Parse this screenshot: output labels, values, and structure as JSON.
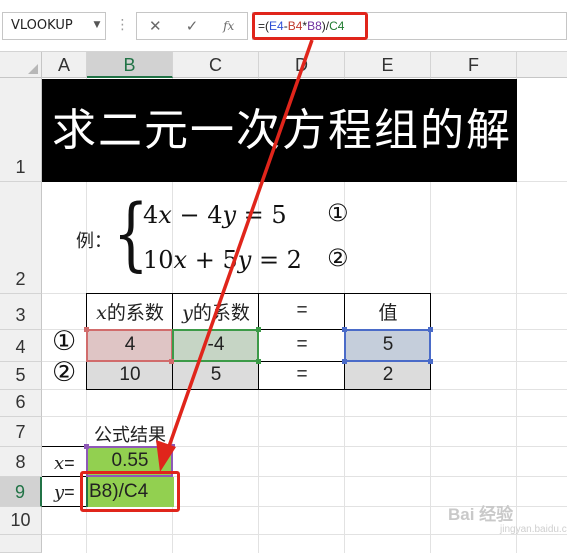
{
  "formula_bar": {
    "name_box": "VLOOKUP",
    "cancel_glyph": "✕",
    "enter_glyph": "✓",
    "fx_label": "fx",
    "formula_parts": [
      {
        "text": "=(",
        "color": "#222222"
      },
      {
        "text": "E4",
        "color": "#2e4fd6"
      },
      {
        "text": "-",
        "color": "#222222"
      },
      {
        "text": "B4",
        "color": "#c0392b"
      },
      {
        "text": "*",
        "color": "#222222"
      },
      {
        "text": "B8",
        "color": "#7030a0"
      },
      {
        "text": ")/",
        "color": "#222222"
      },
      {
        "text": "C4",
        "color": "#1e7a2e"
      }
    ]
  },
  "columns": [
    "A",
    "B",
    "C",
    "D",
    "E",
    "F"
  ],
  "rows": [
    "1",
    "2",
    "3",
    "4",
    "5",
    "6",
    "7",
    "8",
    "9",
    "10"
  ],
  "title": "求二元一次方程组的解",
  "example": {
    "label": "例：",
    "eq1": {
      "c1": "4",
      "v1": "x",
      "op": " − ",
      "c2": "4",
      "v2": "y",
      "rhs": " = 5",
      "mark": "①"
    },
    "eq2": {
      "c1": "10",
      "v1": "x",
      "op": " + ",
      "c2": "5",
      "v2": "y",
      "rhs": " = 2",
      "mark": "②"
    }
  },
  "table": {
    "headers": [
      {
        "var": "x",
        "text": "的系数"
      },
      {
        "var": "y",
        "text": "的系数"
      },
      {
        "var": "",
        "text": "="
      },
      {
        "var": "",
        "text": "值"
      }
    ],
    "rows": [
      {
        "mark": "①",
        "cells": [
          "4",
          "-4",
          "=",
          "5"
        ]
      },
      {
        "mark": "②",
        "cells": [
          "10",
          "5",
          "=",
          "2"
        ]
      }
    ]
  },
  "result": {
    "caption": "公式结果",
    "x_label": "x",
    "y_label": "y",
    "eq_sign": "=",
    "x_value": "0.55",
    "y_edit_text": "B8)/C4"
  },
  "colors": {
    "highlight_red": "#e0251b",
    "cell_green": "#92d050",
    "ref_red_fill": "#dfc5c5",
    "ref_green_fill": "#c6d5c5",
    "ref_blue_fill": "#c5cedb",
    "ref_gray_fill": "#dcdcdc"
  },
  "watermark": {
    "main": "Bai 经验",
    "sub": "jingyan.baidu.com"
  }
}
